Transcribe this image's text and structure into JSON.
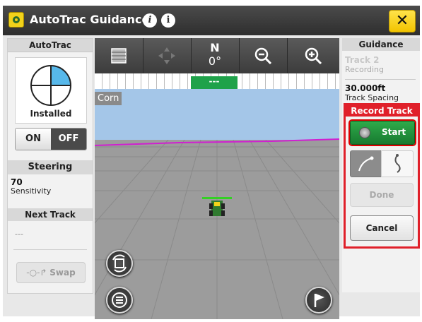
{
  "window": {
    "title": "AutoTrac Guidance",
    "close_label": "✕"
  },
  "left_panel": {
    "autotrac_header": "AutoTrac",
    "status": "Installed",
    "toggle": {
      "on_label": "ON",
      "off_label": "OFF",
      "selected": "OFF"
    },
    "steering_header": "Steering",
    "sensitivity_value": "70",
    "sensitivity_label": "Sensitivity",
    "next_track_header": "Next Track",
    "next_track_value": "---",
    "swap_label": "Swap"
  },
  "map": {
    "heading_letter": "N",
    "heading_degrees": "0°",
    "offset_value": "---",
    "crop_label": "Corn"
  },
  "right_panel": {
    "guidance_header": "Guidance",
    "track_name": "Track 2",
    "track_status": "Recording",
    "track_spacing_value": "30.000ft",
    "track_spacing_label": "Track Spacing",
    "record_track_header": "Record Track",
    "start_label": "Start",
    "done_label": "Done",
    "cancel_label": "Cancel"
  },
  "colors": {
    "accent_yellow": "#f2c400",
    "record_red": "#e0202a",
    "start_green": "#1fa24a",
    "sky_blue": "#a4c6e8",
    "boundary_magenta": "#d020d0",
    "autotrac_fill_blue": "#57b8ea"
  }
}
